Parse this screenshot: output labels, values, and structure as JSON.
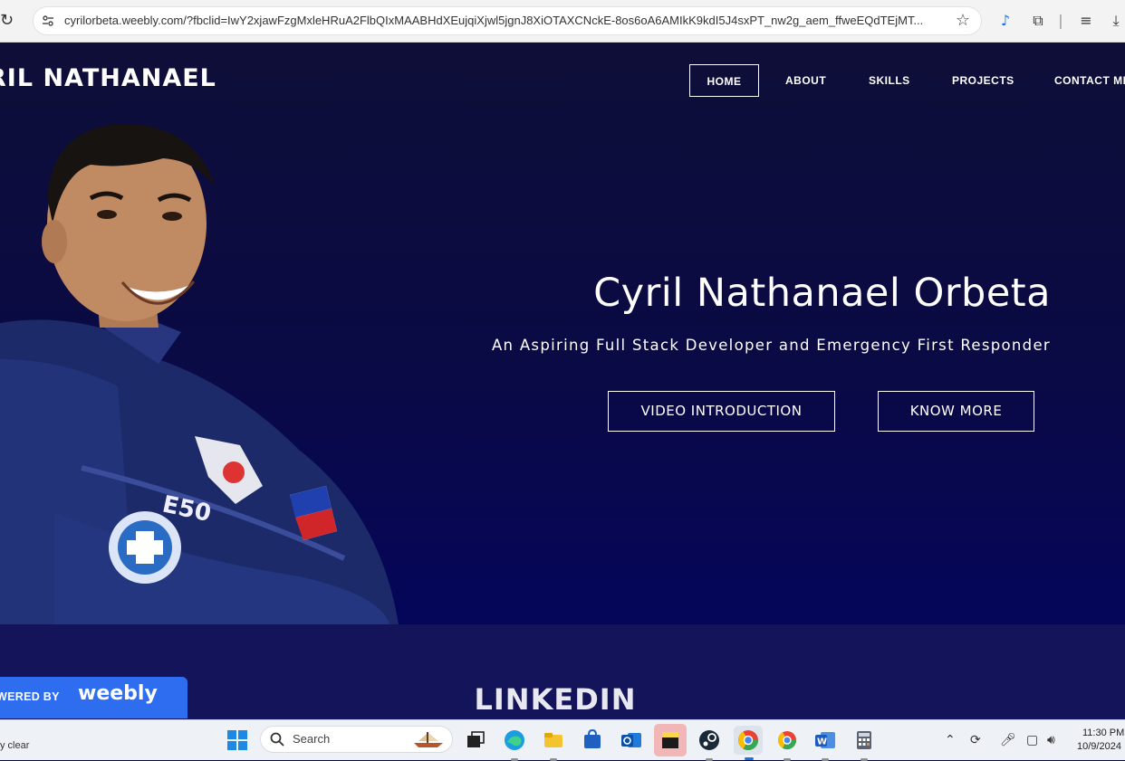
{
  "browser": {
    "url": "cyrilorbeta.weebly.com/?fbclid=IwY2xjawFzgMxleHRuA2FlbQIxMAABHdXEujqiXjwl5jgnJ8XiOTAXCNckE-8os6oA6AMIkK9kdI5J4sxPT_nw2g_aem_ffweEQdTEjMT...",
    "icons": [
      "reload-icon",
      "site-info-icon",
      "star-icon",
      "read-aloud-icon",
      "extensions-icon",
      "reading-list-icon",
      "download-icon"
    ]
  },
  "site": {
    "logo": "RIL NATHANAEL",
    "nav": [
      {
        "label": "HOME",
        "active": true
      },
      {
        "label": "ABOUT"
      },
      {
        "label": "SKILLS"
      },
      {
        "label": "PROJECTS"
      },
      {
        "label": "CONTACT ME"
      }
    ],
    "hero": {
      "name": "Cyril Nathanael Orbeta",
      "tagline": "An Aspiring Full Stack Developer and Emergency First Responder",
      "buttons": [
        "VIDEO INTRODUCTION",
        "KNOW MORE"
      ]
    },
    "section_heading": "LINKEDIN",
    "badge": {
      "powered": "WERED BY",
      "logo": "weebly"
    }
  },
  "colors": {
    "hero_bg": "#0a0a45",
    "section_bg": "#14145a",
    "weebly_blue": "#2f6df0"
  },
  "taskbar": {
    "weather": "y clear",
    "search_label": "Search",
    "time": "11:30 PM",
    "date": "10/9/2024",
    "apps": [
      "task-view",
      "edge",
      "file-explorer",
      "store",
      "outlook",
      "sticky-notes",
      "steam",
      "chrome",
      "chrome-alt",
      "word",
      "calculator"
    ]
  }
}
